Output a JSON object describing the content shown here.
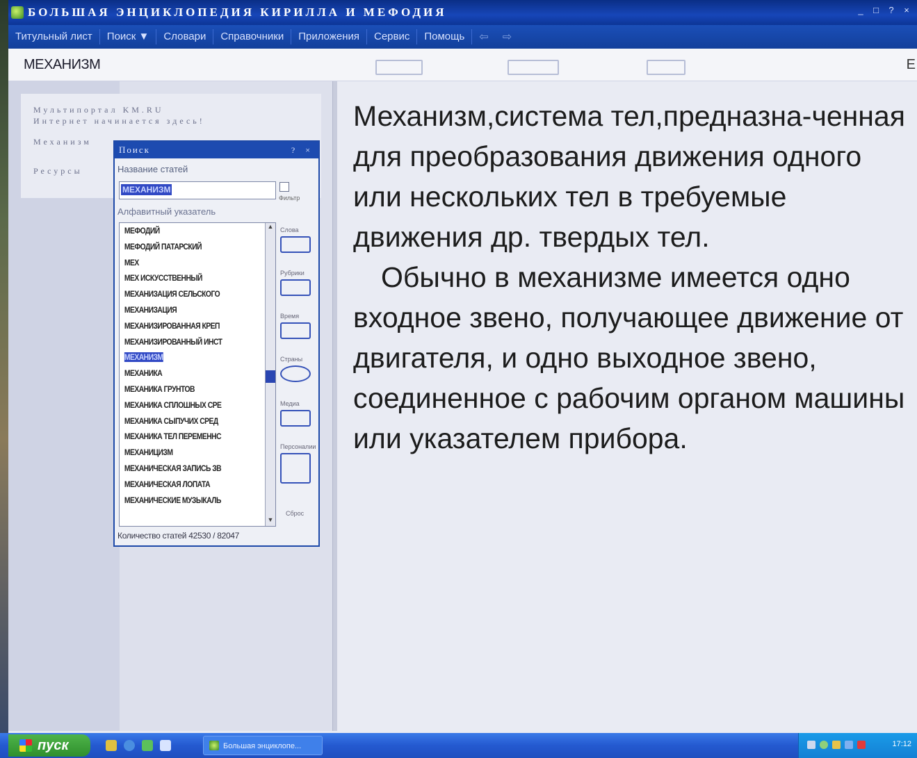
{
  "window": {
    "title": "БОЛЬШАЯ ЭНЦИКЛОПЕДИЯ КИРИЛЛА И МЕФОДИЯ",
    "controls": [
      "_",
      "□",
      "?",
      "×"
    ]
  },
  "menu": {
    "items": [
      "Титульный лист",
      "Поиск ▼",
      "Словари",
      "Справочники",
      "Приложения",
      "Сервис",
      "Помощь"
    ],
    "back": "⇦",
    "forward": "⇨"
  },
  "header": {
    "article_title": "МЕХАНИЗМ",
    "right_text": "Е"
  },
  "promo": {
    "line1": "Мультипортал KM.RU",
    "line2": "Интернет начинается здесь!",
    "line3": "Механизм",
    "line4": "Ресурсы"
  },
  "search_panel": {
    "title": "Поиск",
    "title_buttons": "? ×",
    "name_label": "Название статей",
    "query": "МЕХАНИЗМ",
    "filter_label": "Фильтр",
    "alpha_label": "Алфавитный указатель",
    "items": [
      "МЕФОДИЙ",
      "МЕФОДИЙ ПАТАРСКИЙ",
      "МЕХ",
      "МЕХ ИСКУССТВЕННЫЙ",
      "МЕХАНИЗАЦИЯ СЕЛЬСКОГО",
      "МЕХАНИЗАЦИЯ",
      "МЕХАНИЗИРОВАННАЯ КРЕП",
      "МЕХАНИЗИРОВАННЫЙ ИНСТ",
      "МЕХАНИЗМ",
      "МЕХАНИКА",
      "МЕХАНИКА ГРУНТОВ",
      "МЕХАНИКА СПЛОШНЫХ СРЕ",
      "МЕХАНИКА СЫПУЧИХ СРЕД",
      "МЕХАНИКА ТЕЛ ПЕРЕМЕННС",
      "МЕХАНИЦИЗМ",
      "МЕХАНИЧЕСКАЯ ЗАПИСЬ ЗВ",
      "МЕХАНИЧЕСКАЯ ЛОПАТА",
      "МЕХАНИЧЕСКИЕ МУЗЫКАЛЬ"
    ],
    "selected_index": 8,
    "side_buttons": [
      "Слова",
      "Рубрики",
      "Время",
      "Страны",
      "Медиа",
      "Персоналии",
      "Сброс"
    ],
    "count": "Количество статей 42530 / 82047"
  },
  "article": {
    "p1": "Механизм,система тел,предназна-ченная для преобразования движения одного или нескольких тел в требуемые движения др. твердых тел.",
    "p2": "Обычно в механизме имеется одно входное звено, получающее движение от двигателя, и одно выходное звено, соединенное с рабочим органом машины или указателем прибора."
  },
  "taskbar": {
    "start_label": "пуск",
    "task_label": "Большая энциклопе...",
    "clock": "17:12"
  },
  "colors": {
    "titlebar": "#0a2e86",
    "selection": "#3149c4",
    "start": "#3f9a3a",
    "taskbar": "#2459d0"
  }
}
